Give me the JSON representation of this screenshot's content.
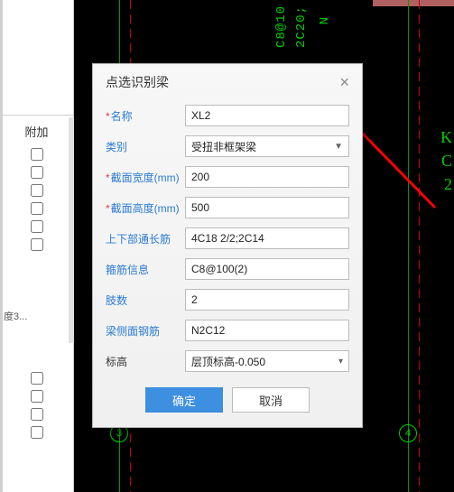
{
  "left": {
    "header": "附加",
    "truncated": "度3...",
    "checkbox_count_top": 6,
    "checkbox_count_bottom": 4
  },
  "cad": {
    "text_rot_1": "C8@10",
    "text_rot_2": "2C20;",
    "text_rot_3": "N",
    "side_letters": [
      "K",
      "C",
      "2"
    ],
    "marker_3": "3",
    "marker_4": "4"
  },
  "dialog": {
    "title": "点选识别梁",
    "fields": {
      "name": {
        "label": "名称",
        "value": "XL2",
        "required": true
      },
      "type": {
        "label": "类别",
        "value": "受扭非框架梁",
        "required": false,
        "dropdown": true
      },
      "width": {
        "label": "截面宽度(mm)",
        "value": "200",
        "required": true
      },
      "height": {
        "label": "截面高度(mm)",
        "value": "500",
        "required": true
      },
      "longbar": {
        "label": "上下部通长筋",
        "value": "4C18 2/2;2C14",
        "required": false
      },
      "stirr": {
        "label": "箍筋信息",
        "value": "C8@100(2)",
        "required": false
      },
      "limbs": {
        "label": "肢数",
        "value": "2",
        "required": false
      },
      "side": {
        "label": "梁侧面钢筋",
        "value": "N2C12",
        "required": false
      },
      "elev": {
        "label": "标高",
        "value": "层顶标高-0.050",
        "required": false,
        "dropdown": true,
        "plain": true
      }
    },
    "buttons": {
      "ok": "确定",
      "cancel": "取消"
    }
  }
}
